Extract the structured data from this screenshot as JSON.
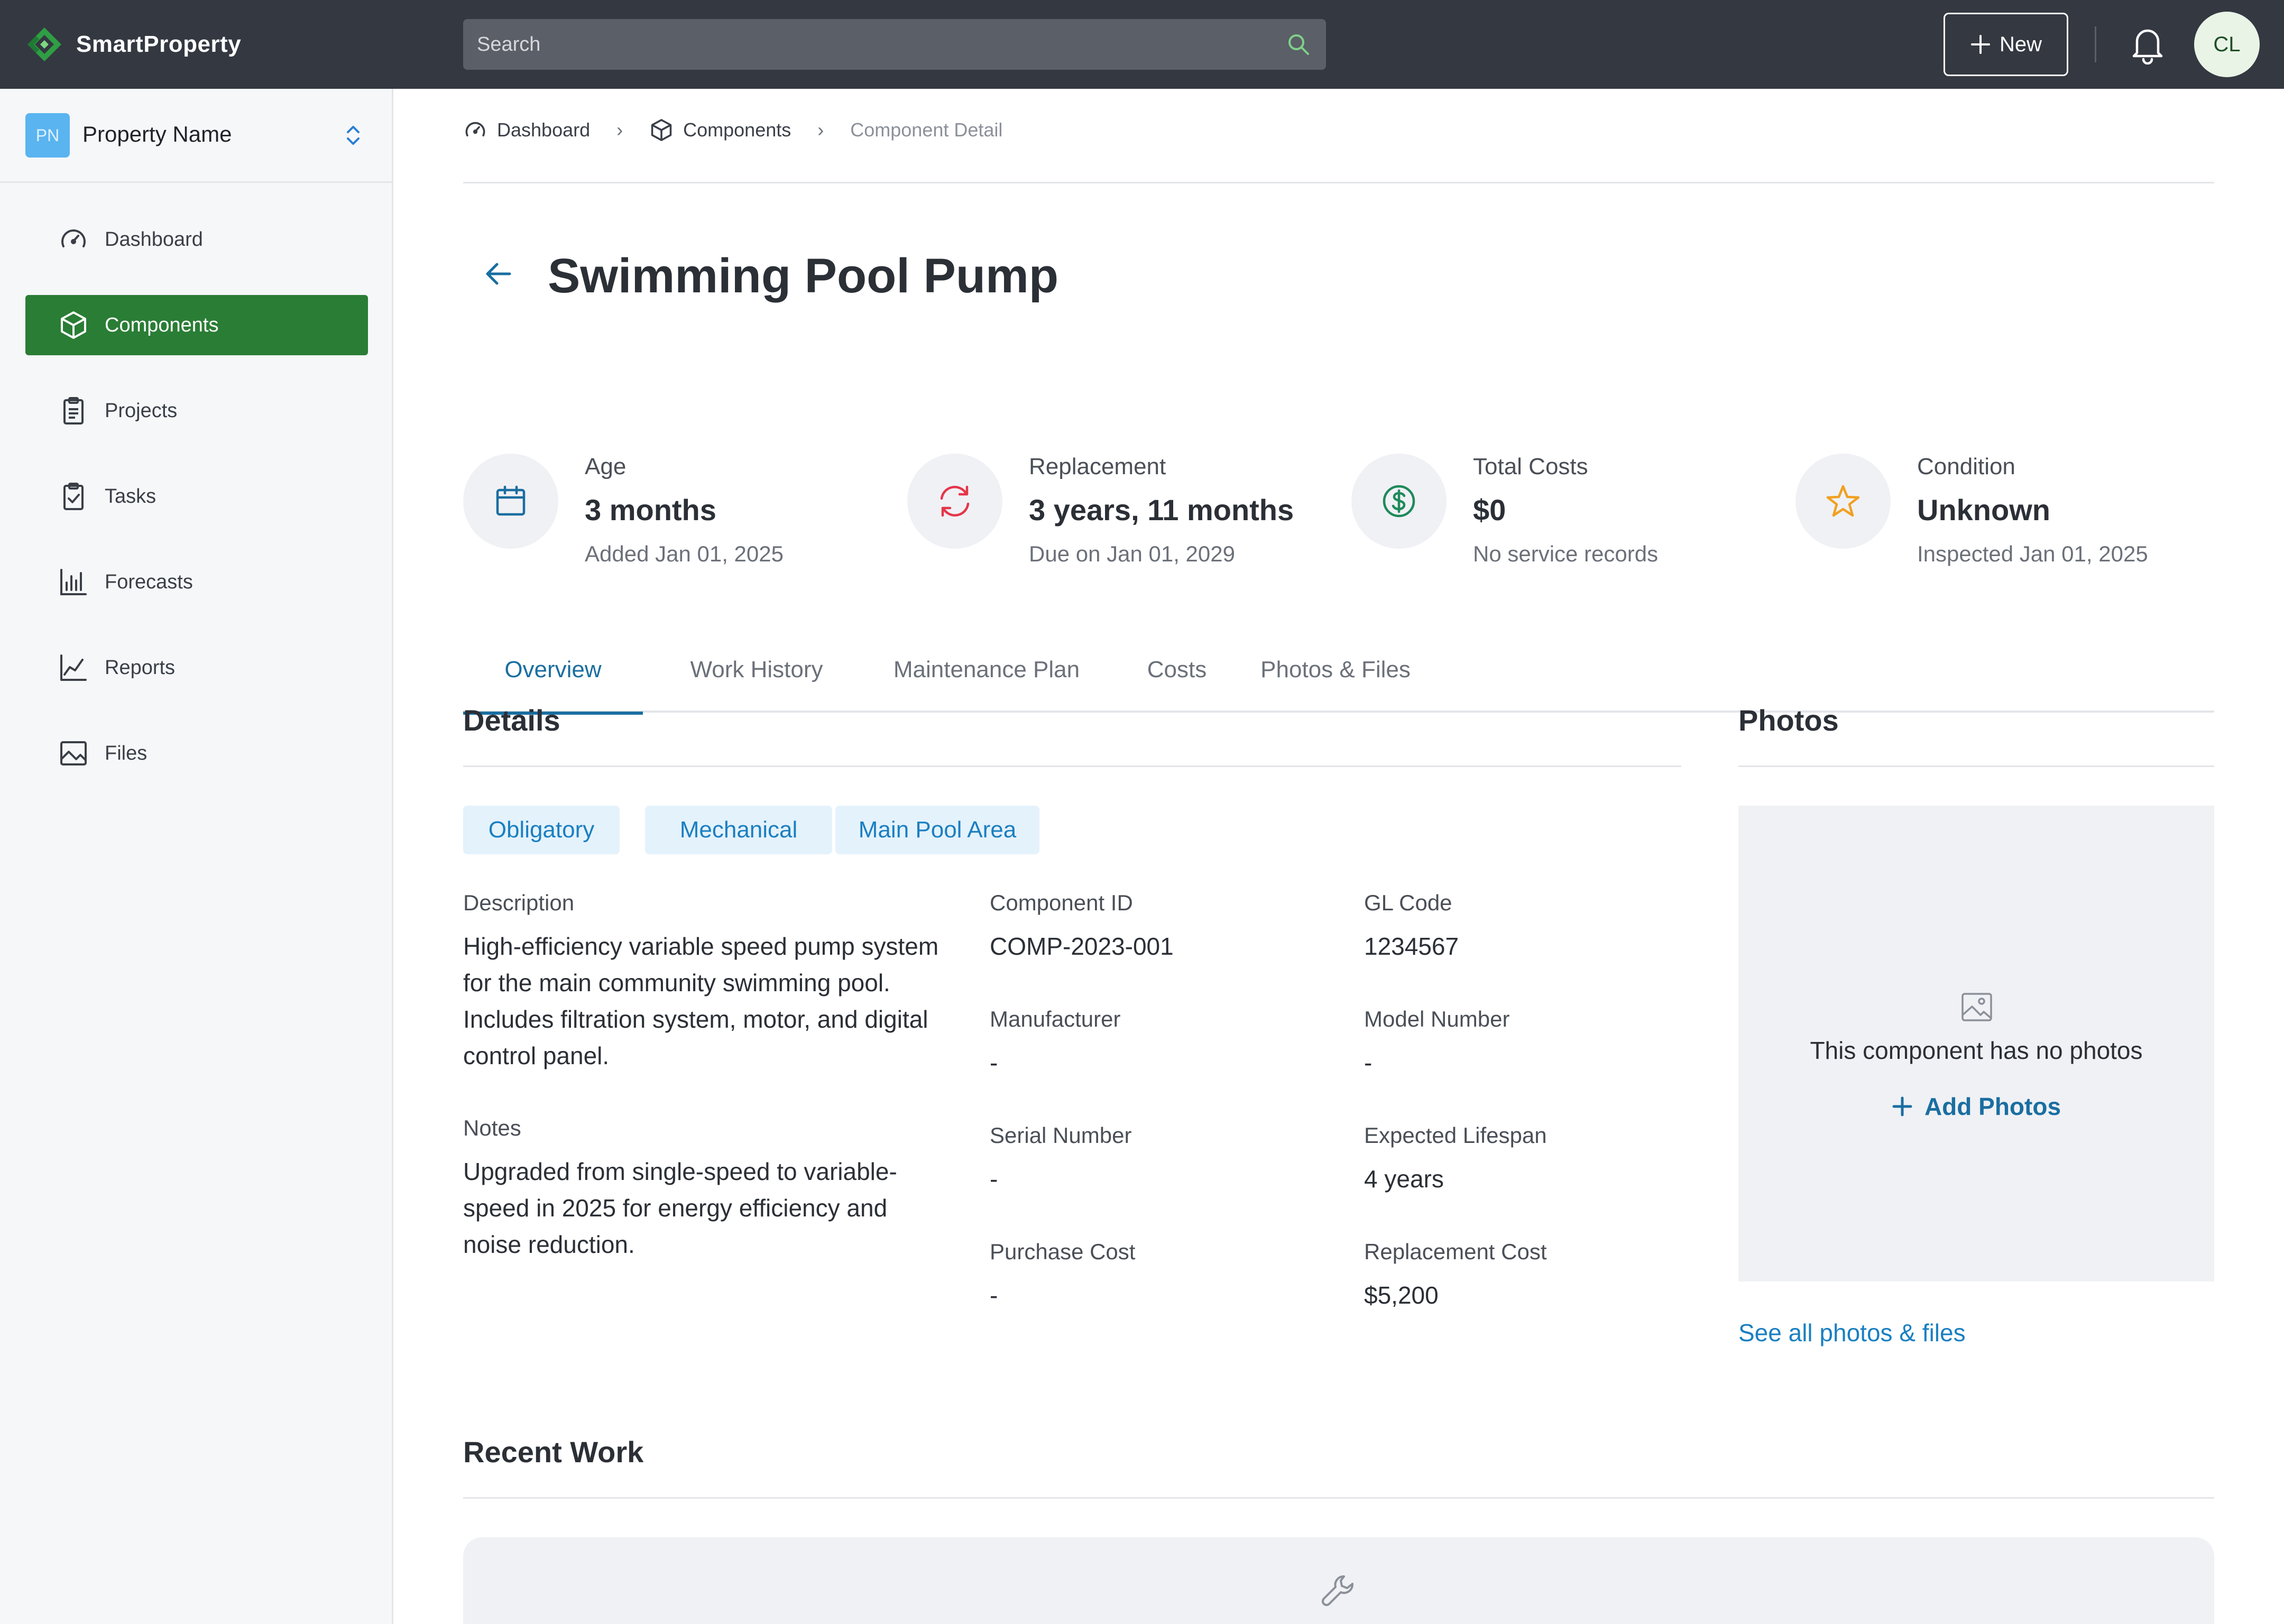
{
  "app": {
    "name": "SmartProperty"
  },
  "search": {
    "placeholder": "Search"
  },
  "header": {
    "new_label": "New",
    "avatar_initials": "CL"
  },
  "property": {
    "badge": "PN",
    "name": "Property Name"
  },
  "sidebar": {
    "items": [
      {
        "label": "Dashboard",
        "icon": "gauge-icon",
        "active": false
      },
      {
        "label": "Components",
        "icon": "cube-icon",
        "active": true
      },
      {
        "label": "Projects",
        "icon": "clipboard-icon",
        "active": false
      },
      {
        "label": "Tasks",
        "icon": "clipboard-check-icon",
        "active": false
      },
      {
        "label": "Forecasts",
        "icon": "bar-chart-icon",
        "active": false
      },
      {
        "label": "Reports",
        "icon": "line-chart-icon",
        "active": false
      },
      {
        "label": "Files",
        "icon": "image-icon",
        "active": false
      }
    ]
  },
  "breadcrumb": {
    "items": [
      {
        "label": "Dashboard",
        "icon": "gauge-icon"
      },
      {
        "label": "Components",
        "icon": "cube-icon"
      },
      {
        "label": "Component Detail"
      }
    ]
  },
  "page": {
    "title": "Swimming Pool Pump"
  },
  "stats": [
    {
      "label": "Age",
      "value": "3 months",
      "sub": "Added Jan 01, 2025",
      "icon": "calendar-icon",
      "color": "#1a6ea0"
    },
    {
      "label": "Replacement",
      "value": "3 years, 11 months",
      "sub": "Due on Jan 01, 2029",
      "icon": "refresh-icon",
      "color": "#e5364a"
    },
    {
      "label": "Total Costs",
      "value": "$0",
      "sub": "No service records",
      "icon": "dollar-circle-icon",
      "color": "#1e8a5a"
    },
    {
      "label": "Condition",
      "value": "Unknown",
      "sub": "Inspected Jan 01, 2025",
      "icon": "star-icon",
      "color": "#f0a020"
    }
  ],
  "tabs": [
    {
      "label": "Overview",
      "active": true
    },
    {
      "label": "Work History",
      "active": false
    },
    {
      "label": "Maintenance Plan",
      "active": false
    },
    {
      "label": "Costs",
      "active": false
    },
    {
      "label": "Photos & Files",
      "active": false
    }
  ],
  "details": {
    "title": "Details",
    "tags": [
      "Obligatory",
      "Mechanical",
      "Main Pool Area"
    ],
    "description_label": "Description",
    "description": "High-efficiency variable speed pump system for the main community swimming pool. Includes filtration system, motor, and digital control panel.",
    "notes_label": "Notes",
    "notes": "Upgraded from single-speed to variable-speed in 2025 for energy efficiency and noise reduction.",
    "fields": [
      {
        "label": "Component ID",
        "value": "COMP-2023-001"
      },
      {
        "label": "GL Code",
        "value": "1234567"
      },
      {
        "label": "Manufacturer",
        "value": "-"
      },
      {
        "label": "Model Number",
        "value": "-"
      },
      {
        "label": "Serial Number",
        "value": "-"
      },
      {
        "label": "Expected Lifespan",
        "value": "4 years"
      },
      {
        "label": "Purchase Cost",
        "value": "-"
      },
      {
        "label": "Replacement Cost",
        "value": "$5,200"
      }
    ]
  },
  "photos": {
    "title": "Photos",
    "empty_text": "This component has no photos",
    "add_label": "Add Photos",
    "see_all": "See all photos & files"
  },
  "recent_work": {
    "title": "Recent Work"
  },
  "colors": {
    "topbar": "#343841",
    "brand_green": "#2a7d35",
    "accent_blue": "#1a6ea0",
    "tag_bg": "#e4f2fc"
  }
}
